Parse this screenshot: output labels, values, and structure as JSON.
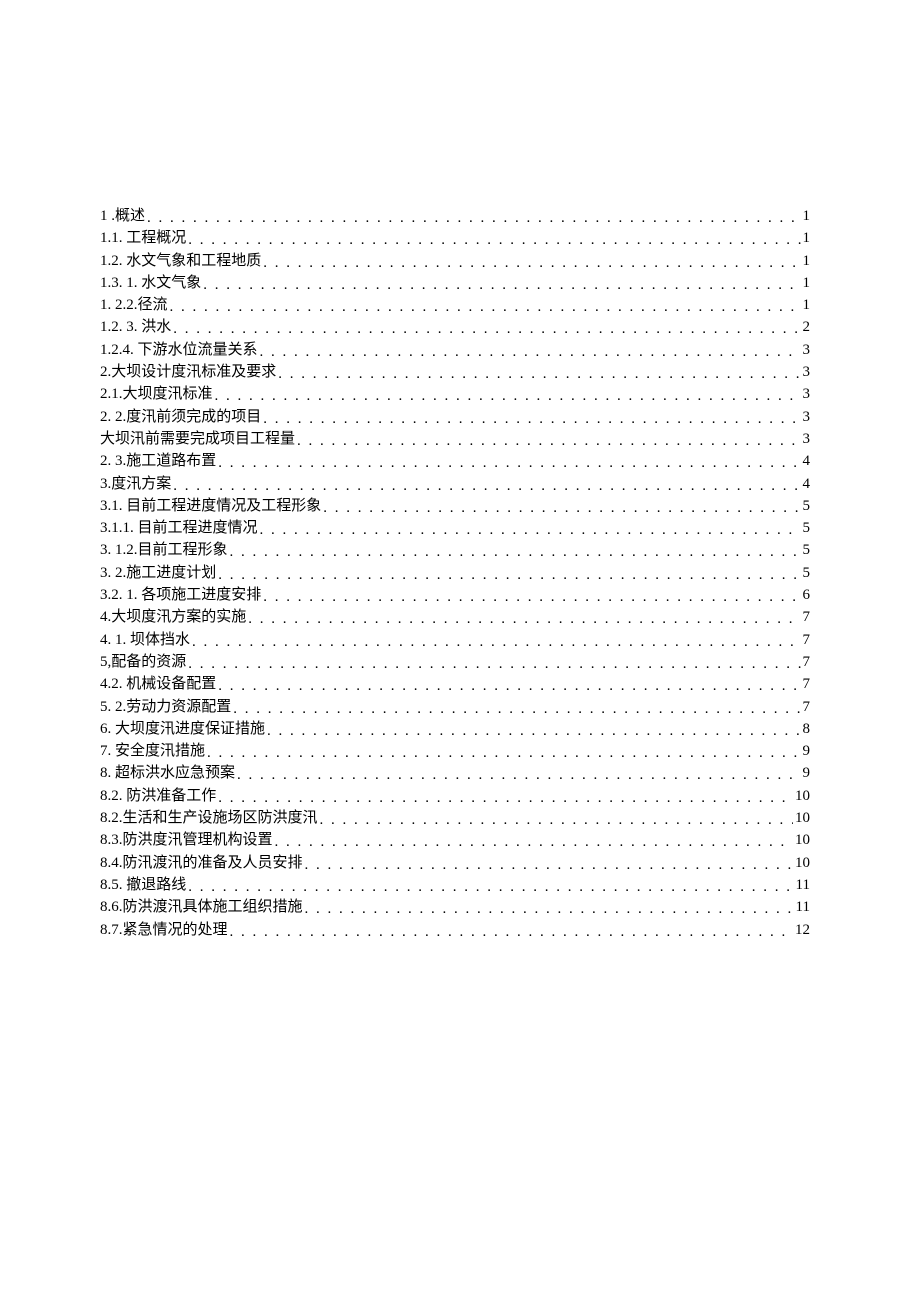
{
  "toc": [
    {
      "label": "1 .概述",
      "page": "1"
    },
    {
      "label": "1.1.  工程概况 ",
      "page": "1"
    },
    {
      "label": "1.2.  水文气象和工程地质 ",
      "page": "1"
    },
    {
      "label": "1.3.  1. 水文气象 ",
      "page": "1"
    },
    {
      "label": "1.  2.2.径流 ",
      "page": "1"
    },
    {
      "label": "1.2.  3. 洪水 ",
      "page": "2"
    },
    {
      "label": "1.2.4.  下游水位流量关系 ",
      "page": "3"
    },
    {
      "label": "2.大坝设计度汛标准及要求 ",
      "page": "3"
    },
    {
      "label": "2.1.大坝度汛标准 ",
      "page": "3"
    },
    {
      "label": "2.  2.度汛前须完成的项目",
      "page": "3"
    },
    {
      "label": "大坝汛前需要完成项目工程量",
      "page": "3"
    },
    {
      "label": "2.  3.施工道路布置",
      "page": "4"
    },
    {
      "label": "3.度汛方案 ",
      "page": "4"
    },
    {
      "label": "3.1.  目前工程进度情况及工程形象 ",
      "page": "5"
    },
    {
      "label": "3.1.1.  目前工程进度情况 ",
      "page": "5"
    },
    {
      "label": "3.  1.2.目前工程形象 ",
      "page": "5"
    },
    {
      "label": "3.  2.施工进度计划",
      "page": "5"
    },
    {
      "label": "3.2.  1. 各项施工进度安排 ",
      "page": "6"
    },
    {
      "label": "4.大坝度汛方案的实施 ",
      "page": "7"
    },
    {
      "label": "4.  1. 坝体挡水 ",
      "page": "7"
    },
    {
      "label": "5,配备的资源 ",
      "page": "7"
    },
    {
      "label": "4.2.  机械设备配置 ",
      "page": "7"
    },
    {
      "label": "5.  2.劳动力资源配置",
      "page": "7"
    },
    {
      "label": "6.  大坝度汛进度保证措施 ",
      "page": "8"
    },
    {
      "label": "7.  安全度汛措施 ",
      "page": "9"
    },
    {
      "label": "8.  超标洪水应急预案 ",
      "page": "9"
    },
    {
      "label": "8.2.  防洪准备工作 ",
      "page": "10"
    },
    {
      "label": "8.2.生活和生产设施场区防洪度汛 ",
      "page": "10"
    },
    {
      "label": "8.3.防洪度汛管理机构设置 ",
      "page": "10"
    },
    {
      "label": "8.4.防汛渡汛的准备及人员安排 ",
      "page": "10"
    },
    {
      "label": "8.5. 撤退路线",
      "page": "11"
    },
    {
      "label": "8.6.防洪渡汛具体施工组织措施 ",
      "page": "11"
    },
    {
      "label": "8.7.紧急情况的处理 ",
      "page": "12"
    }
  ]
}
